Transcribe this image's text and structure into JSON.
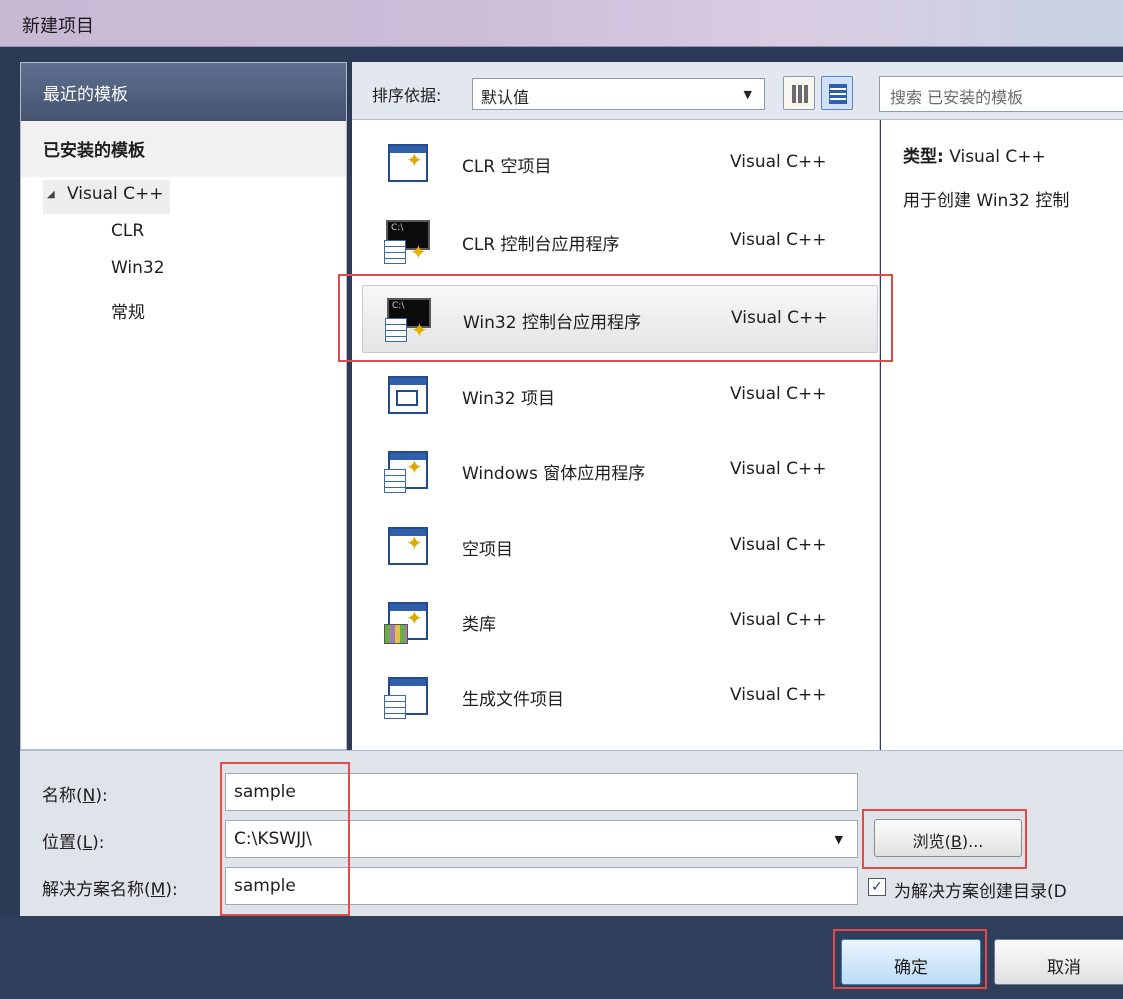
{
  "window": {
    "title": "新建项目"
  },
  "left_pane": {
    "recent_header": "最近的模板",
    "installed_header": "已安装的模板",
    "tree": {
      "root": "Visual C++",
      "children": [
        "CLR",
        "Win32",
        "常规"
      ]
    }
  },
  "toolbar": {
    "sort_label": "排序依据:",
    "sort_value": "默认值",
    "search_placeholder": "搜索 已安装的模板"
  },
  "templates": [
    {
      "name": "CLR 空项目",
      "language": "Visual C++",
      "icon": "empty-project-icon"
    },
    {
      "name": "CLR 控制台应用程序",
      "language": "Visual C++",
      "icon": "console-app-icon"
    },
    {
      "name": "Win32 控制台应用程序",
      "language": "Visual C++",
      "icon": "console-app-icon",
      "selected": true
    },
    {
      "name": "Win32 项目",
      "language": "Visual C++",
      "icon": "win32-project-icon"
    },
    {
      "name": "Windows 窗体应用程序",
      "language": "Visual C++",
      "icon": "windows-forms-icon"
    },
    {
      "name": "空项目",
      "language": "Visual C++",
      "icon": "empty-project-icon"
    },
    {
      "name": "类库",
      "language": "Visual C++",
      "icon": "class-library-icon"
    },
    {
      "name": "生成文件项目",
      "language": "Visual C++",
      "icon": "makefile-project-icon"
    }
  ],
  "description": {
    "type_label": "类型:",
    "type_value": "Visual C++",
    "text": "用于创建 Win32 控制"
  },
  "form": {
    "name_label_prefix": "名称(",
    "name_label_key": "N",
    "name_label_suffix": "):",
    "name_value": "sample",
    "location_label_prefix": "位置(",
    "location_label_key": "L",
    "location_label_suffix": "):",
    "location_value": "C:\\KSWJJ\\",
    "solution_label_prefix": "解决方案名称(",
    "solution_label_key": "M",
    "solution_label_suffix": "):",
    "solution_value": "sample",
    "browse_prefix": "浏览(",
    "browse_key": "B",
    "browse_suffix": ")...",
    "create_dir_label": "为解决方案创建目录(D",
    "create_dir_checked": true
  },
  "footer": {
    "ok_label": "确定",
    "cancel_label": "取消"
  },
  "colors": {
    "highlight": "#e34a4a",
    "header_dark": "#44536f",
    "footer": "#2f3e5b"
  }
}
